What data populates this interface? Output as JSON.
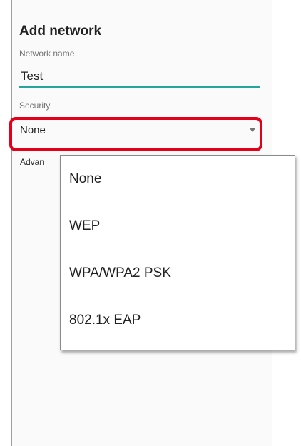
{
  "dialog": {
    "title": "Add network",
    "network_name": {
      "label": "Network name",
      "value": "Test"
    },
    "security": {
      "label": "Security",
      "value": "None"
    },
    "advanced_label": "Advan"
  },
  "security_menu": {
    "options": [
      {
        "label": "None"
      },
      {
        "label": "WEP"
      },
      {
        "label": "WPA/WPA2 PSK"
      },
      {
        "label": "802.1x EAP"
      }
    ]
  },
  "colors": {
    "accent_underline": "#26a69a",
    "highlight_border": "#e3001b"
  },
  "icons": {
    "dropdown": "chevron-down-icon"
  }
}
